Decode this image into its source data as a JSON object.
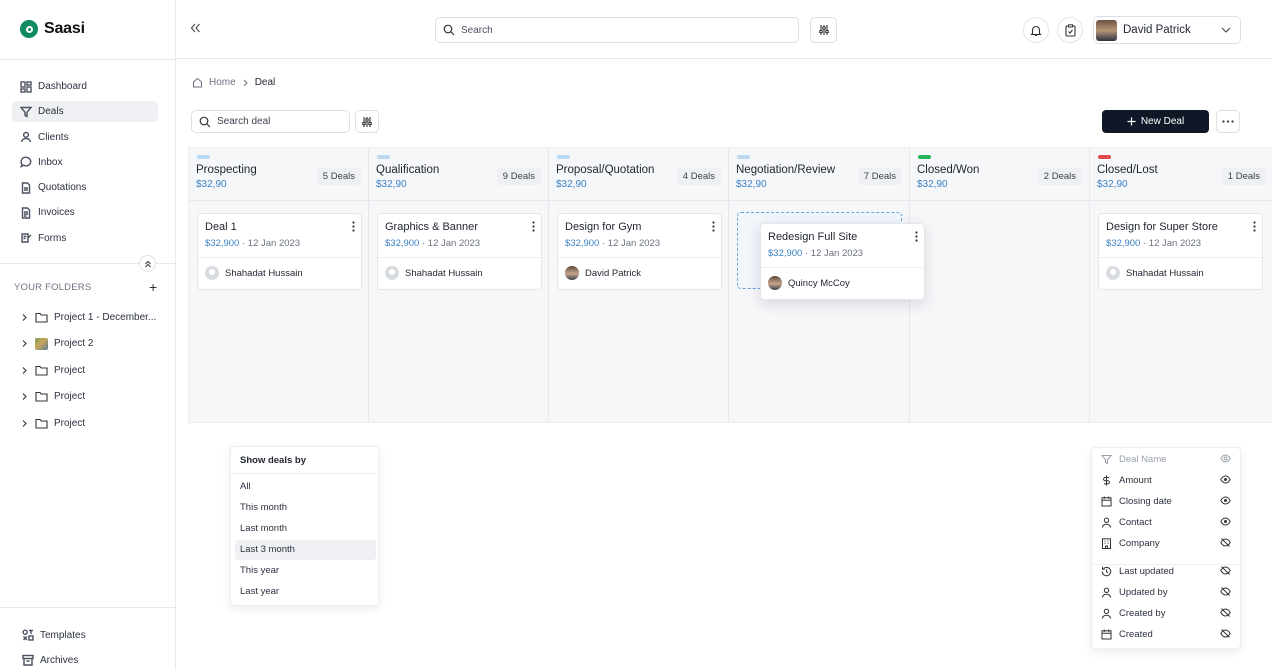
{
  "app": {
    "name": "Saasi"
  },
  "sidebar": {
    "nav": [
      {
        "label": "Dashboard",
        "icon": "dashboard-icon",
        "active": false
      },
      {
        "label": "Deals",
        "icon": "filter-icon",
        "active": true
      },
      {
        "label": "Clients",
        "icon": "user-icon",
        "active": false
      },
      {
        "label": "Inbox",
        "icon": "chat-icon",
        "active": false
      },
      {
        "label": "Quotations",
        "icon": "document-icon",
        "active": false
      },
      {
        "label": "Invoices",
        "icon": "invoice-icon",
        "active": false
      },
      {
        "label": "Forms",
        "icon": "form-icon",
        "active": false
      }
    ],
    "folders_title": "YOUR FOLDERS",
    "folders": [
      {
        "label": "Project 1 - December...",
        "icon": "folder-icon"
      },
      {
        "label": "Project 2",
        "icon": "image-thumbnail"
      },
      {
        "label": "Project",
        "icon": "folder-icon"
      },
      {
        "label": "Project",
        "icon": "folder-icon"
      },
      {
        "label": "Project",
        "icon": "folder-icon"
      }
    ],
    "bottom": [
      {
        "label": "Templates",
        "icon": "templates-icon"
      },
      {
        "label": "Archives",
        "icon": "archive-icon"
      }
    ]
  },
  "header": {
    "search_placeholder": "Search",
    "user_name": "David Patrick"
  },
  "breadcrumb": {
    "home": "Home",
    "current": "Deal"
  },
  "toolbar": {
    "deal_search_placeholder": "Search deal",
    "new_deal_label": "New Deal"
  },
  "columns": [
    {
      "title": "Prospecting",
      "amount": "$32,90",
      "count": "5 Deals",
      "color": "#bcd9f3"
    },
    {
      "title": "Qualification",
      "amount": "$32,90",
      "count": "9 Deals",
      "color": "#bcd9f3"
    },
    {
      "title": "Proposal/Quotation",
      "amount": "$32,90",
      "count": "4 Deals",
      "color": "#bcd9f3"
    },
    {
      "title": "Negotiation/Review",
      "amount": "$32,90",
      "count": "7 Deals",
      "color": "#bcd9f3"
    },
    {
      "title": "Closed/Won",
      "amount": "$32,90",
      "count": "2 Deals",
      "color": "#22b75a"
    },
    {
      "title": "Closed/Lost",
      "amount": "$32,90",
      "count": "1 Deals",
      "color": "#e5484d"
    }
  ],
  "cards": [
    {
      "title": "Deal 1",
      "amount": "$32,900",
      "date": "· 12 Jan 2023",
      "owner": "Shahadat Hussain"
    },
    {
      "title": "Graphics & Banner",
      "amount": "$32,900",
      "date": "· 12 Jan 2023",
      "owner": "Shahadat Hussain"
    },
    {
      "title": "Design for Gym",
      "amount": "$32,900",
      "date": "· 12 Jan 2023",
      "owner": "David Patrick"
    },
    {
      "title": "Redesign Full Site",
      "amount": "$32,900",
      "date": "· 12 Jan 2023",
      "owner": "Quincy McCoy"
    },
    {
      "title": "Design for Super Store",
      "amount": "$32,900",
      "date": "· 12 Jan 2023",
      "owner": "Shahadat Hussain"
    }
  ],
  "show_deals": {
    "title": "Show deals by",
    "options": [
      "All",
      "This month",
      "Last month",
      "Last 3 month",
      "This year",
      "Last year"
    ],
    "selected": "Last 3 month"
  },
  "fields_menu": [
    {
      "label": "Deal Name",
      "icon": "filter-icon",
      "visible": true,
      "muted": true
    },
    {
      "label": "Amount",
      "icon": "dollar-icon",
      "visible": true
    },
    {
      "label": "Closing date",
      "icon": "calendar-icon",
      "visible": true
    },
    {
      "label": "Contact",
      "icon": "user-icon",
      "visible": true
    },
    {
      "label": "Company",
      "icon": "building-icon",
      "visible": false
    },
    {
      "label": "Last updated",
      "icon": "history-icon",
      "visible": false
    },
    {
      "label": "Updated by",
      "icon": "user-icon",
      "visible": false
    },
    {
      "label": "Created by",
      "icon": "user-icon",
      "visible": false
    },
    {
      "label": "Created",
      "icon": "calendar-icon",
      "visible": false
    }
  ]
}
